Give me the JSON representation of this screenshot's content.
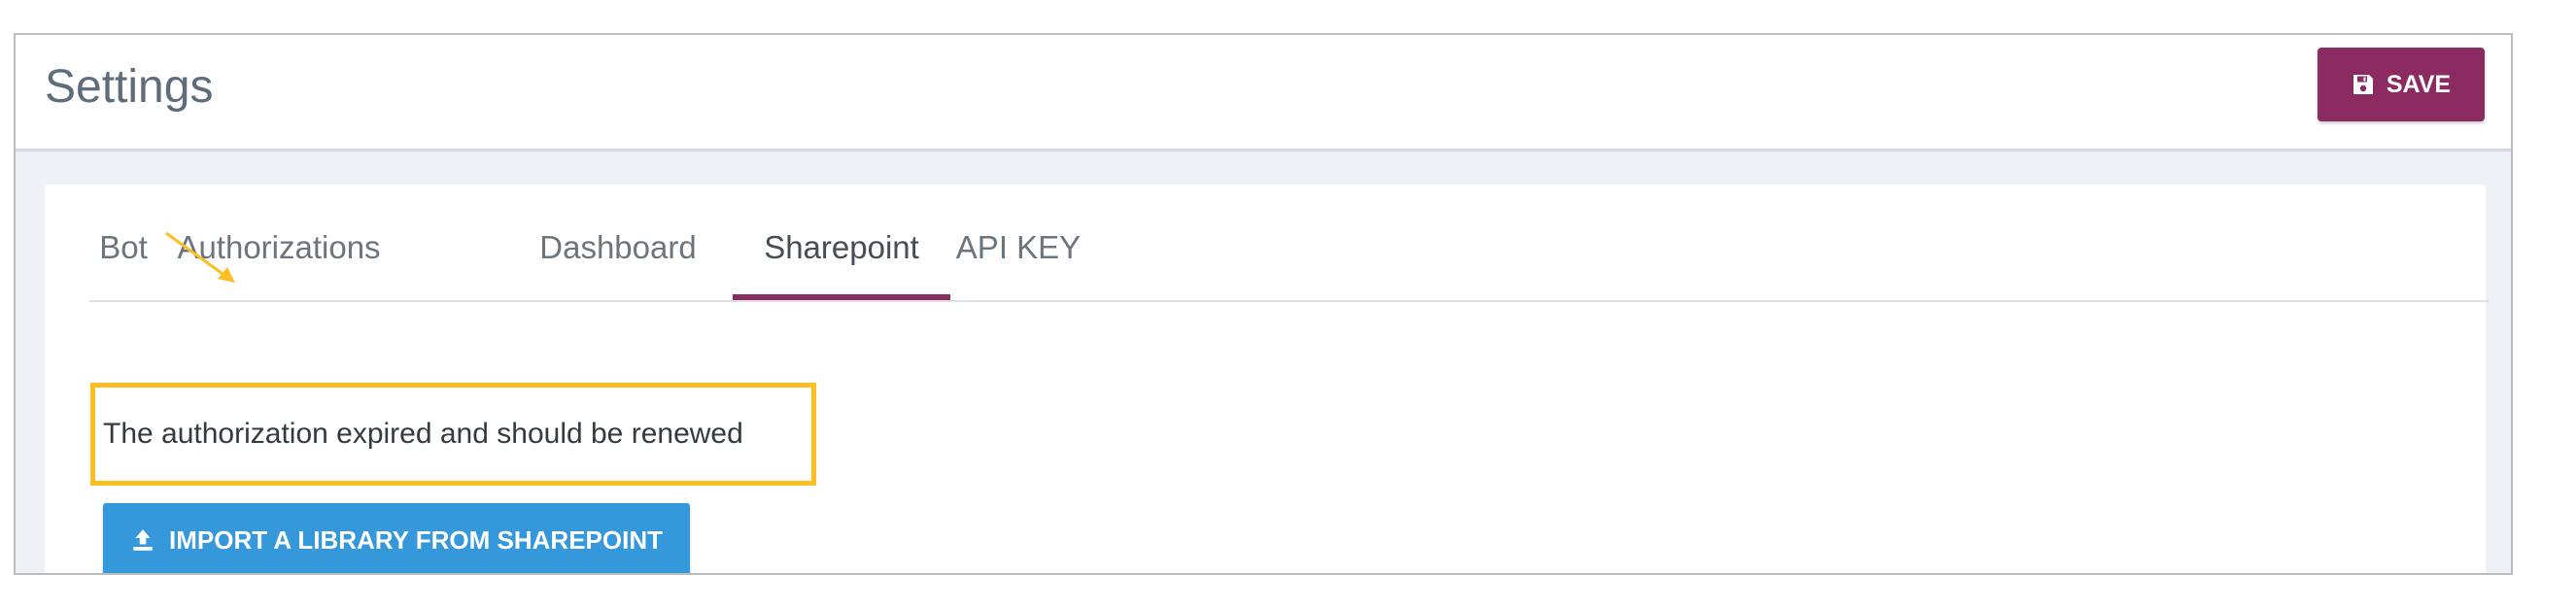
{
  "header": {
    "title": "Settings",
    "save_label": "SAVE",
    "save_icon": "floppy-disk-icon"
  },
  "tabs": [
    {
      "label": "Bot",
      "active": false
    },
    {
      "label": "Authorizations",
      "active": false
    },
    {
      "label": "Dashboard",
      "active": false
    },
    {
      "label": "Sharepoint",
      "active": true
    },
    {
      "label": "API KEY",
      "active": false
    }
  ],
  "notice": {
    "text": "The authorization expired and should be renewed"
  },
  "import": {
    "label": "IMPORT A LIBRARY FROM SHAREPOINT",
    "icon": "upload-icon"
  },
  "colors": {
    "primary": "#8c2a62",
    "button_blue": "#3498db",
    "highlight": "#fbbf24"
  }
}
